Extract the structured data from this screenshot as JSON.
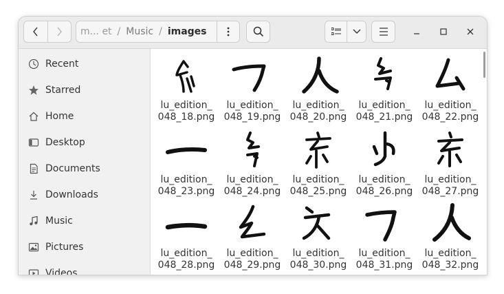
{
  "window": {
    "path": {
      "truncated": "m... et",
      "music": "Music",
      "current": "images"
    }
  },
  "sidebar": {
    "items": [
      {
        "label": "Recent",
        "icon": "clock-icon"
      },
      {
        "label": "Starred",
        "icon": "star-icon"
      },
      {
        "label": "Home",
        "icon": "home-icon"
      },
      {
        "label": "Desktop",
        "icon": "desktop-icon"
      },
      {
        "label": "Documents",
        "icon": "document-icon"
      },
      {
        "label": "Downloads",
        "icon": "download-icon"
      },
      {
        "label": "Music",
        "icon": "music-icon"
      },
      {
        "label": "Pictures",
        "icon": "picture-icon"
      },
      {
        "label": "Videos",
        "icon": "video-icon"
      }
    ]
  },
  "files": [
    {
      "line1": "lu_edition_",
      "line2": "048_18.png"
    },
    {
      "line1": "lu_edition_",
      "line2": "048_19.png"
    },
    {
      "line1": "lu_edition_",
      "line2": "048_20.png"
    },
    {
      "line1": "lu_edition_",
      "line2": "048_21.png"
    },
    {
      "line1": "lu_edition_",
      "line2": "048_22.png"
    },
    {
      "line1": "lu_edition_",
      "line2": "048_23.png"
    },
    {
      "line1": "lu_edition_",
      "line2": "048_24.png"
    },
    {
      "line1": "lu_edition_",
      "line2": "048_25.png"
    },
    {
      "line1": "lu_edition_",
      "line2": "048_26.png"
    },
    {
      "line1": "lu_edition_",
      "line2": "048_27.png"
    },
    {
      "line1": "lu_edition_",
      "line2": "048_28.png"
    },
    {
      "line1": "lu_edition_",
      "line2": "048_29.png"
    },
    {
      "line1": "lu_edition_",
      "line2": "048_30.png"
    },
    {
      "line1": "lu_edition_",
      "line2": "048_31.png"
    },
    {
      "line1": "lu_edition_",
      "line2": "048_32.png"
    }
  ]
}
